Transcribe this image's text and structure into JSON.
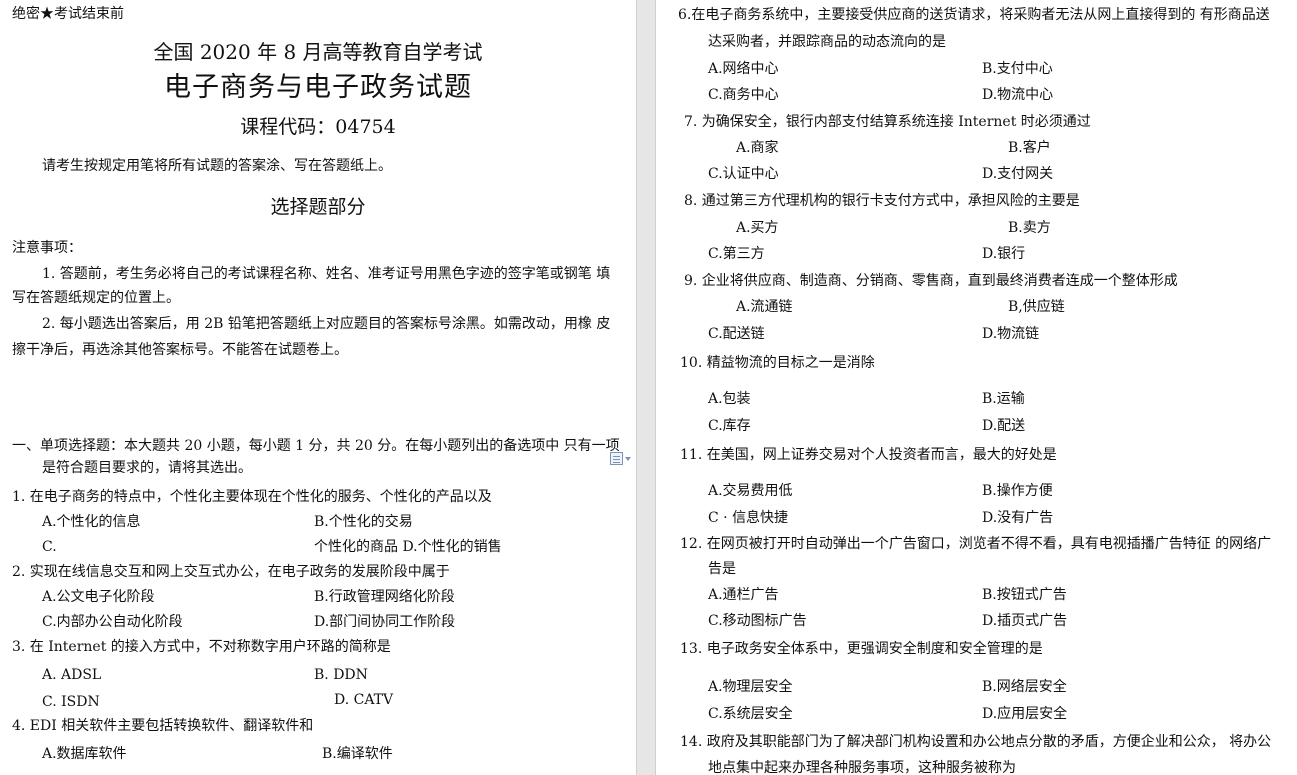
{
  "left": {
    "secret": "绝密★考试结束前",
    "exam_title": "全国 2020 年 8 月高等教育自学考试",
    "subject_title": "电子商务与电子政务试题",
    "course_code": "课程代码：04754",
    "instruction": "请考生按规定用笔将所有试题的答案涂、写在答题纸上。",
    "section_title": "选择题部分",
    "notes_heading": "注意事项：",
    "note1_line1": "1.   答题前，考生务必将自己的考试课程名称、姓名、准考证号用黑色字迹的签字笔或钢笔 填",
    "note1_line2": "写在答题纸规定的位置上。",
    "note2_line1": "2.   每小题选出答案后，用 2B 铅笔把答题纸上对应题目的答案标号涂黑。如需改动，用橡 皮",
    "note2_line2": "擦干净后，再选涂其他答案标号。不能答在试题卷上。",
    "part1_line1": "一、单项选择题：本大题共 20 小题，每小题 1 分，共 20 分。在每小题列出的备选项中 只有一项",
    "part1_line2": "是符合题目要求的，请将其选出。",
    "q1": "1.     在电子商务的特点中，个性化主要体现在个性化的服务、个性化的产品以及",
    "q1a": "A.个性化的信息",
    "q1b": "B.个性化的交易",
    "q1c": "C.",
    "q1cd": "个性化的商品    D.个性化的销售",
    "q2": "2.     实现在线信息交互和网上交互式办公，在电子政务的发展阶段中属于",
    "q2a": "A.公文电子化阶段",
    "q2b": "B.行政管理网络化阶段",
    "q2c": "C.内部办公自动化阶段",
    "q2d": "D.部门间协同工作阶段",
    "q3": "3.     在 Internet 的接入方式中，不对称数字用户环路的简称是",
    "q3a": "A. ADSL",
    "q3b": "B.     DDN",
    "q3c": "C. ISDN",
    "q3d": "D.     CATV",
    "q4": "4.     EDI 相关软件主要包括转换软件、翻译软件和",
    "q4a": "A.数据库软件",
    "q4b": "B.编译软件"
  },
  "right": {
    "q6_line1": "6.在电子商务系统中，主要接受供应商的送货请求，将采购者无法从网上直接得到的 有形商品送",
    "q6_line2": "达采购者，并跟踪商品的动态流向的是",
    "q6a": "A.网络中心",
    "q6b": "B.支付中心",
    "q6c": "C.商务中心",
    "q6d": "D.物流中心",
    "q7": "7.    为确保安全，银行内部支付结算系统连接 Internet 时必须通过",
    "q7a": "A.商家",
    "q7b": "B.客户",
    "q7c": "C.认证中心",
    "q7d": "D.支付网关",
    "q8": "8.    通过第三方代理机构的银行卡支付方式中，承担风险的主要是",
    "q8a": "A.买方",
    "q8b": "B.卖方",
    "q8c": "C.第三方",
    "q8d": "D.银行",
    "q9": "9.    企业将供应商、制造商、分销商、零售商，直到最终消费者连成一个整体形成",
    "q9a": "A.流通链",
    "q9b": "B,供应链",
    "q9c": "C.配送链",
    "q9d": "D.物流链",
    "q10": "10.    精益物流的目标之一是消除",
    "q10a": "A.包装",
    "q10b": "B.运输",
    "q10c": "C.库存",
    "q10d": "D.配送",
    "q11": "11.    在美国，网上证券交易对个人投资者而言，最大的好处是",
    "q11a": "A.交易费用低",
    "q11b": "B.操作方便",
    "q11c": "C · 信息快捷",
    "q11d": "D.没有广告",
    "q12_line1": "12.   在网页被打开时自动弹出一个广告窗口，浏览者不得不看，具有电视插播广告特征 的网络广",
    "q12_line2": "告是",
    "q12a": "A.通栏广告",
    "q12b": "B.按钮式广告",
    "q12c": "C.移动图标广告",
    "q12d": "D.插页式广告",
    "q13": "13.    电子政务安全体系中，更强调安全制度和安全管理的是",
    "q13a": "A.物理层安全",
    "q13b": "B.网络层安全",
    "q13c": "C.系统层安全",
    "q13d": "D.应用层安全",
    "q14_line1": "14.   政府及其职能部门为了解决部门机构设置和办公地点分散的矛盾，方便企业和公众，  将办公",
    "q14_line2": "地点集中起来办理各种服务事项，这种服务被称为"
  }
}
